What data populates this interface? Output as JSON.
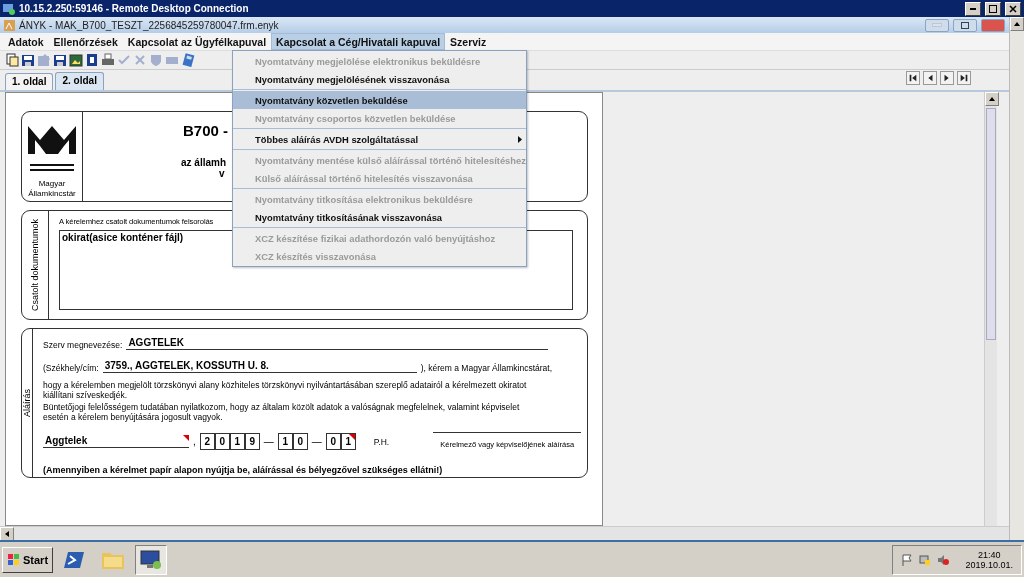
{
  "rdp_window": {
    "title": "10.15.2.250:59146 - Remote Desktop Connection"
  },
  "app_window": {
    "title": "ÁNYK - MAK_B700_TESZT_2256845259780047.frm.enyk"
  },
  "menu_bar": [
    {
      "label": "Adatok",
      "selected": false
    },
    {
      "label": "Ellenőrzések",
      "selected": false
    },
    {
      "label": "Kapcsolat az Ügyfélkapuval",
      "selected": false
    },
    {
      "label": "Kapcsolat a Cég/Hivatali kapuval",
      "selected": true
    },
    {
      "label": "Szerviz",
      "selected": false
    }
  ],
  "toolbar": [
    {
      "kind": "copy",
      "disabled": false
    },
    {
      "kind": "save",
      "disabled": false
    },
    {
      "kind": "edit",
      "disabled": true
    },
    {
      "kind": "save",
      "disabled": false
    },
    {
      "kind": "image",
      "disabled": false
    },
    {
      "kind": "book",
      "disabled": false
    },
    {
      "kind": "print",
      "disabled": false
    },
    {
      "kind": "check",
      "disabled": true
    },
    {
      "kind": "cross",
      "disabled": true
    },
    {
      "kind": "shield",
      "disabled": true
    },
    {
      "kind": "box",
      "disabled": true
    },
    {
      "kind": "calculator",
      "disabled": false
    }
  ],
  "tabs": [
    {
      "label": "1. oldal",
      "selected": false
    },
    {
      "label": "2. oldal",
      "selected": true
    }
  ],
  "page_nav": [
    {
      "kind": "first"
    },
    {
      "kind": "prev"
    },
    {
      "kind": "next"
    },
    {
      "kind": "last"
    }
  ],
  "dropdown": {
    "groups": [
      [
        {
          "label": "Nyomtatvány megjelölése elektronikus beküldésre",
          "disabled": true,
          "selected": false,
          "submenu": false
        },
        {
          "label": "Nyomtatvány megjelölésének visszavonása",
          "disabled": false,
          "selected": false,
          "submenu": false
        }
      ],
      [
        {
          "label": "Nyomtatvány közvetlen beküldése",
          "disabled": false,
          "selected": true,
          "submenu": false
        },
        {
          "label": "Nyomtatvány csoportos közvetlen beküldése",
          "disabled": true,
          "selected": false,
          "submenu": false
        }
      ],
      [
        {
          "label": "Többes aláírás AVDH szolgáltatással",
          "disabled": false,
          "selected": false,
          "submenu": true
        }
      ],
      [
        {
          "label": "Nyomtatvány mentése külső aláírással történő hitelesítéshez",
          "disabled": true,
          "selected": false,
          "submenu": false
        },
        {
          "label": "Külső aláírással történő hitelesítés visszavonása",
          "disabled": true,
          "selected": false,
          "submenu": false
        }
      ],
      [
        {
          "label": "Nyomtatvány titkosítása elektronikus beküldésre",
          "disabled": true,
          "selected": false,
          "submenu": false
        },
        {
          "label": "Nyomtatvány titkosításának visszavonása",
          "disabled": false,
          "selected": false,
          "submenu": false
        }
      ],
      [
        {
          "label": "XCZ készítése fizikai adathordozón való benyújtáshoz",
          "disabled": true,
          "selected": false,
          "submenu": false
        },
        {
          "label": "XCZ készítés visszavonása",
          "disabled": true,
          "selected": false,
          "submenu": false
        }
      ]
    ]
  },
  "form": {
    "header": {
      "logo_caption": "Magyar Államkincstár",
      "title": "B700 -",
      "subtitle_lines": [
        "az államh",
        "v"
      ]
    },
    "attachments": {
      "label": "Csatolt dokumentumok",
      "intro": "A kérelemhez csatolt dokumentumok felsorolás",
      "list_value": "okirat(asice konténer fájl)"
    },
    "signature": {
      "label": "Aláírás",
      "org_label": "Szerv megnevezése:",
      "org_value": "AGGTELEK",
      "address_prefix": "(Székhely/cím:",
      "address_value": "3759., AGGTELEK, KOSSUTH U. 8.",
      "address_suffix": "), kérem a Magyar Államkincstárat,",
      "paragraph_1": "hogy a kérelemben megjelölt törzskönyvi alany közhiteles törzskönyvi nyilvántartásában szereplő adatairól a kérelmezett okiratot kiállítani szíveskedjék.",
      "paragraph_2": "Büntetőjogi felelősségem tudatában nyilatkozom, hogy az általam közölt adatok a valóságnak megfelelnek, valamint képviselet esetén a kérelem benyújtására jogosult vagyok.",
      "place": {
        "value": "Aggtelek",
        "marked": true
      },
      "comma": ",",
      "date": {
        "year": [
          "2",
          "0",
          "1",
          "9"
        ],
        "separator_1": "—",
        "month": [
          "1",
          "0"
        ],
        "separator_2": "—",
        "day": [
          "0",
          "1"
        ],
        "day_marked": true
      },
      "stamp": "P.H.",
      "signature_caption": "Kérelmező vagy képviselőjének aláírása",
      "note": "(Amennyiben a kérelmet papír alapon nyújtja be, aláírással és bélyegzővel szükséges ellátni!)"
    }
  },
  "taskbar": {
    "start": "Start",
    "apps": [
      {
        "kind": "powershell",
        "selected": false
      },
      {
        "kind": "folder",
        "selected": false
      },
      {
        "kind": "remote-desktop",
        "selected": true
      }
    ],
    "time": "21:40",
    "date": "2019.10.01."
  }
}
